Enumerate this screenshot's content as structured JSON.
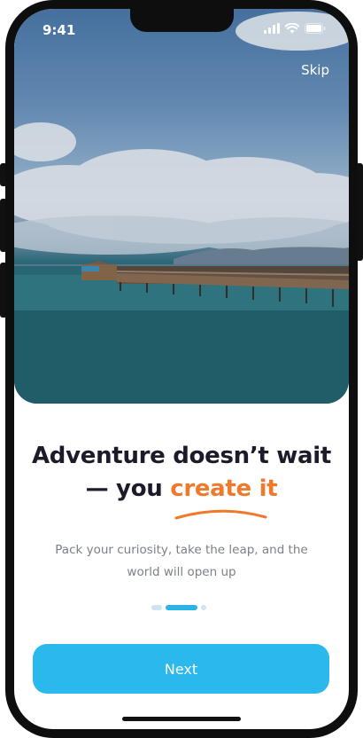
{
  "status_bar": {
    "time": "9:41"
  },
  "header": {
    "skip_label": "Skip"
  },
  "onboarding": {
    "title_line1": "Adventure doesn’t wait",
    "title_line2_prefix": "— you ",
    "title_highlight": "create it",
    "subtitle": "Pack your curiosity, take the leap, and the world will open up",
    "pages": {
      "total": 3,
      "current": 2
    }
  },
  "actions": {
    "next_label": "Next"
  },
  "colors": {
    "accent": "#f07a2c",
    "primary": "#2bb8ec",
    "title": "#1b1b2a",
    "subtitle": "#7d7f8a"
  },
  "icons": [
    "signal-icon",
    "wifi-icon",
    "battery-icon"
  ]
}
